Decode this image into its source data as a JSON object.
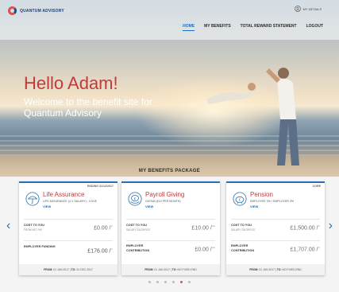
{
  "brand": {
    "name": "QUANTUM ADVISORY",
    "primary": "#1d6fb8",
    "accent": "#c23a3a"
  },
  "header": {
    "my_details": "MY DETAILS",
    "nav": [
      {
        "label": "HOME",
        "active": true
      },
      {
        "label": "MY BENEFITS",
        "active": false
      },
      {
        "label": "TOTAL REWARD STATEMENT",
        "active": false
      },
      {
        "label": "LOGOUT",
        "active": false
      }
    ]
  },
  "hero": {
    "greeting": "Hello Adam!",
    "welcome": "Welcome to the benefit site for Quantum Advisory"
  },
  "package": {
    "title": "MY BENEFITS PACKAGE",
    "cards": [
      {
        "tag": "ENDING 31/12/2017",
        "icon": "umbrella-icon",
        "title": "Life Assurance",
        "subtitle": "LIFE ASSURANCE (4 X SALARY) - COVE",
        "view": "VIEW",
        "cost_label": "COST TO YOU",
        "cost_sublabel": "FROM NET PAY",
        "cost_value": "£0.00 /",
        "cost_period": "yr",
        "employer_label": "EMPLOYER FUNDING",
        "employer_sublabel": "",
        "employer_value": "£176.00 /",
        "employer_period": "yr",
        "from_label": "FROM:",
        "from": "01 JAN 2017",
        "to_label": "TO:",
        "to": "31 DEC 2017"
      },
      {
        "tag": "",
        "icon": "pound-coin-icon",
        "title": "Payroll Giving",
        "subtitle": "OXFAM (£10 PER MONTH)",
        "view": "VIEW",
        "cost_label": "COST TO YOU",
        "cost_sublabel": "SALARY SACRIFICE",
        "cost_value": "£10.00 /",
        "cost_period": "mo",
        "employer_label": "EMPLOYER",
        "employer_sublabel": "CONTRIBUTION",
        "employer_value": "£0.00 /",
        "employer_period": "mo",
        "from_label": "FROM:",
        "from": "01 JAN 2017",
        "to_label": "TO:",
        "to": "NO FIXED END"
      },
      {
        "tag": "CORE",
        "icon": "piggy-bank-icon",
        "title": "Pension",
        "subtitle": "EMPLOYEE 3% / EMPLOYER 3%",
        "view": "VIEW",
        "cost_label": "COST TO YOU",
        "cost_sublabel": "SALARY SACRIFICE",
        "cost_value": "£1,500.00 /",
        "cost_period": "yr",
        "employer_label": "EMPLOYER",
        "employer_sublabel": "CONTRIBUTION",
        "employer_value": "£1,707.00 /",
        "employer_period": "yr",
        "from_label": "FROM:",
        "from": "01 JAN 2017",
        "to_label": "TO:",
        "to": "NO FIXED END"
      }
    ],
    "carousel": {
      "prev": "‹",
      "next": "›",
      "dots": 6,
      "active_dot": 5
    }
  }
}
